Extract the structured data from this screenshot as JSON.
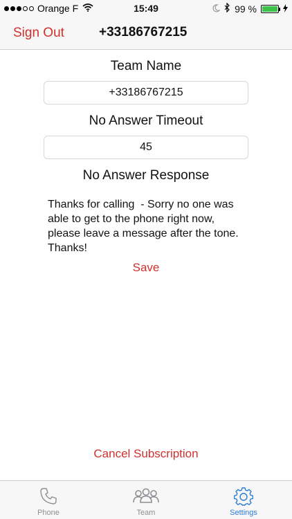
{
  "status_bar": {
    "carrier": "Orange F",
    "time": "15:49",
    "battery_percent": "99 %",
    "battery_level": 0.99,
    "signal_bars_filled": 3,
    "signal_bars_total": 5
  },
  "nav": {
    "sign_out_label": "Sign Out",
    "title": "+33186767215"
  },
  "form": {
    "team_name_label": "Team Name",
    "team_name_value": "+33186767215",
    "timeout_label": "No Answer Timeout",
    "timeout_value": "45",
    "response_label": "No Answer Response",
    "response_value": "Thanks for calling  - Sorry no one was able to get to the phone right now, please leave a message after the tone. Thanks!",
    "save_label": "Save"
  },
  "cancel_subscription_label": "Cancel Subscription",
  "tabs": [
    {
      "label": "Phone",
      "icon": "phone-icon",
      "active": false
    },
    {
      "label": "Team",
      "icon": "team-icon",
      "active": false
    },
    {
      "label": "Settings",
      "icon": "gear-icon",
      "active": true
    }
  ],
  "colors": {
    "accent_red": "#d0312d",
    "active_tab_blue": "#2b7bd6",
    "inactive_tab_gray": "#8e8e93"
  }
}
